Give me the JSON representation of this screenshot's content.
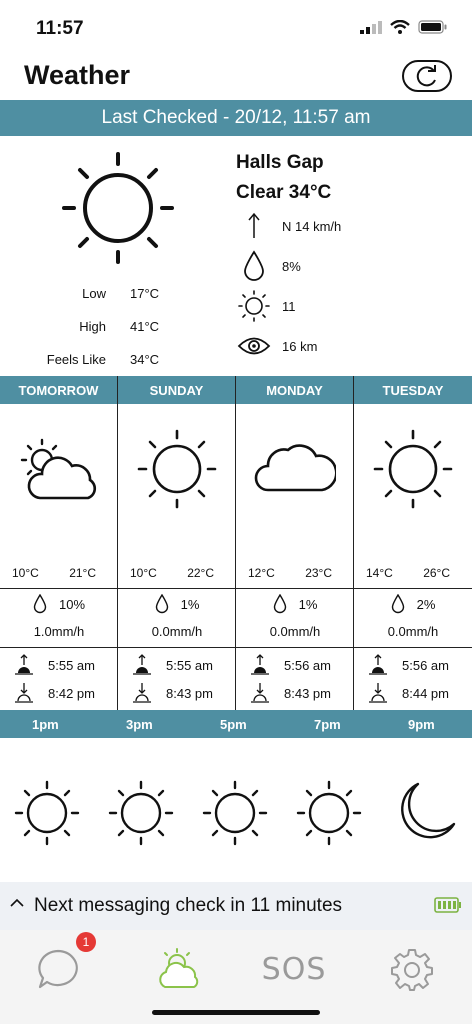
{
  "status": {
    "time": "11:57"
  },
  "nav": {
    "title": "Weather",
    "refresh_icon": "refresh-icon"
  },
  "last_checked": "Last Checked - 20/12, 11:57 am",
  "current": {
    "location": "Halls Gap",
    "condition": "Clear 34°C",
    "wind": "N 14 km/h",
    "rain_chance": "8%",
    "uv": "11",
    "visibility": "16 km",
    "stats": [
      {
        "label": "Low",
        "value": "17°C"
      },
      {
        "label": "High",
        "value": "41°C"
      },
      {
        "label": "Feels Like",
        "value": "34°C"
      }
    ]
  },
  "days": [
    {
      "name": "TOMORROW",
      "icon": "partly-cloudy-icon",
      "low": "10°C",
      "high": "21°C",
      "rain": "10%",
      "mm": "1.0mm/h",
      "sunrise": "5:55 am",
      "sunset": "8:42 pm"
    },
    {
      "name": "SUNDAY",
      "icon": "sun-icon",
      "low": "10°C",
      "high": "22°C",
      "rain": "1%",
      "mm": "0.0mm/h",
      "sunrise": "5:55 am",
      "sunset": "8:43 pm"
    },
    {
      "name": "MONDAY",
      "icon": "cloud-icon",
      "low": "12°C",
      "high": "23°C",
      "rain": "1%",
      "mm": "0.0mm/h",
      "sunrise": "5:56 am",
      "sunset": "8:43 pm"
    },
    {
      "name": "TUESDAY",
      "icon": "sun-icon",
      "low": "14°C",
      "high": "26°C",
      "rain": "2%",
      "mm": "0.0mm/h",
      "sunrise": "5:56 am",
      "sunset": "8:44 pm"
    }
  ],
  "hours": [
    {
      "label": "1pm",
      "icon": "sun-icon"
    },
    {
      "label": "3pm",
      "icon": "sun-icon"
    },
    {
      "label": "5pm",
      "icon": "sun-icon"
    },
    {
      "label": "7pm",
      "icon": "sun-icon"
    },
    {
      "label": "9pm",
      "icon": "moon-icon"
    }
  ],
  "message_bar": {
    "text": "Next messaging check in 11 minutes"
  },
  "tabs": {
    "messages_badge": "1",
    "sos_label": "SOS",
    "active_color": "#8bc34a"
  },
  "colors": {
    "accent": "#4f8fa2"
  }
}
